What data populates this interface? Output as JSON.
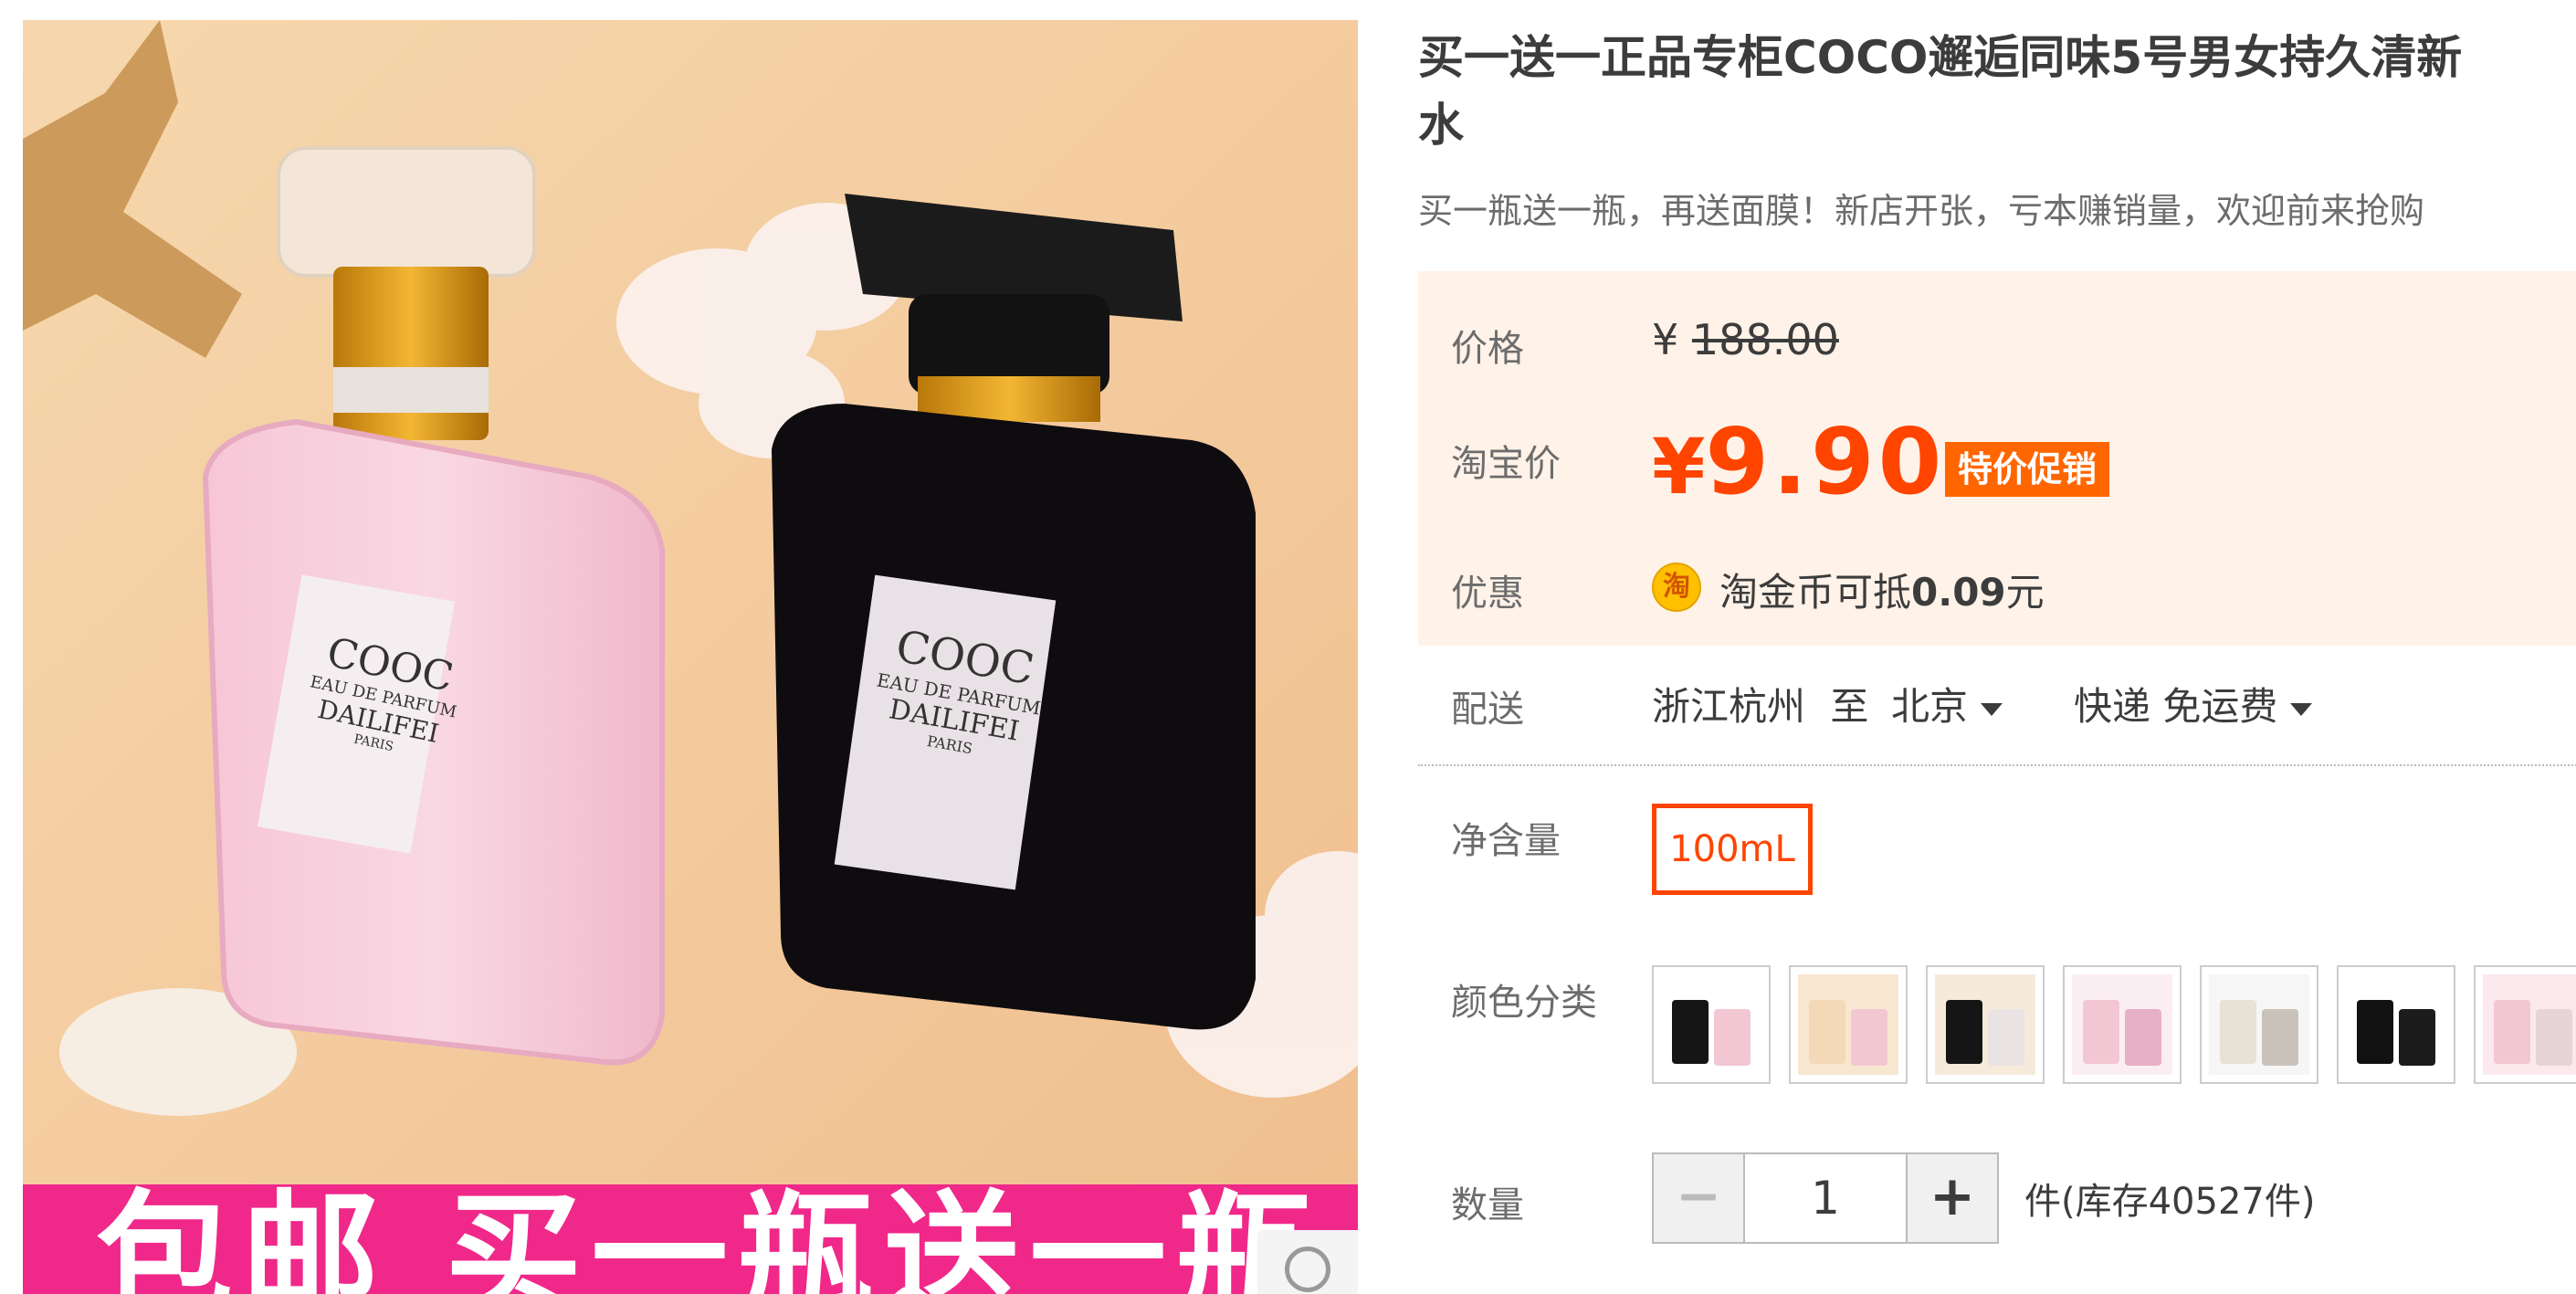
{
  "gallery": {
    "banner_text": "包邮  买一瓶送一瓶",
    "bottle_label_line1": "COOC",
    "bottle_label_line2": "EAU DE PARFUM",
    "bottle_label_line3": "DAILIFEI",
    "bottle_label_line4": "PARIS"
  },
  "product": {
    "title_line1": "买一送一正品专柜COCO邂逅同味5号男女持久清新",
    "title_line2": "水",
    "subtitle": "买一瓶送一瓶，再送面膜！新店开张，亏本赚销量，欢迎前来抢购"
  },
  "pricing": {
    "price_label": "价格",
    "currency": "¥",
    "original_price": "188.00",
    "tb_price_label": "淘宝价",
    "tb_currency": "¥",
    "tb_price": "9.90",
    "promo_tag": "特价促销",
    "discount_label": "优惠",
    "coin_icon_text": "淘",
    "coin_text_prefix": "淘金币可抵",
    "coin_amount": "0.09",
    "coin_unit": "元"
  },
  "shipping": {
    "label": "配送",
    "from": "浙江杭州",
    "to_word": "至",
    "destination": "北京",
    "method": "快递 免运费"
  },
  "spec": {
    "label": "净含量",
    "selected": "100mL"
  },
  "colors": {
    "label": "颜色分类",
    "swatches": [
      {
        "name": "black-and-pink"
      },
      {
        "name": "gold-and-pink"
      },
      {
        "name": "black-and-clear"
      },
      {
        "name": "pink-box"
      },
      {
        "name": "clear-box"
      },
      {
        "name": "black-box"
      },
      {
        "name": "pink-and-clear"
      }
    ]
  },
  "quantity": {
    "label": "数量",
    "minus": "−",
    "value": "1",
    "plus": "+",
    "stock_text": "件(库存40527件)"
  },
  "colors_theme": {
    "accent": "#ff4400",
    "price_bg": "#fff2e8",
    "banner": "#f0288a"
  }
}
